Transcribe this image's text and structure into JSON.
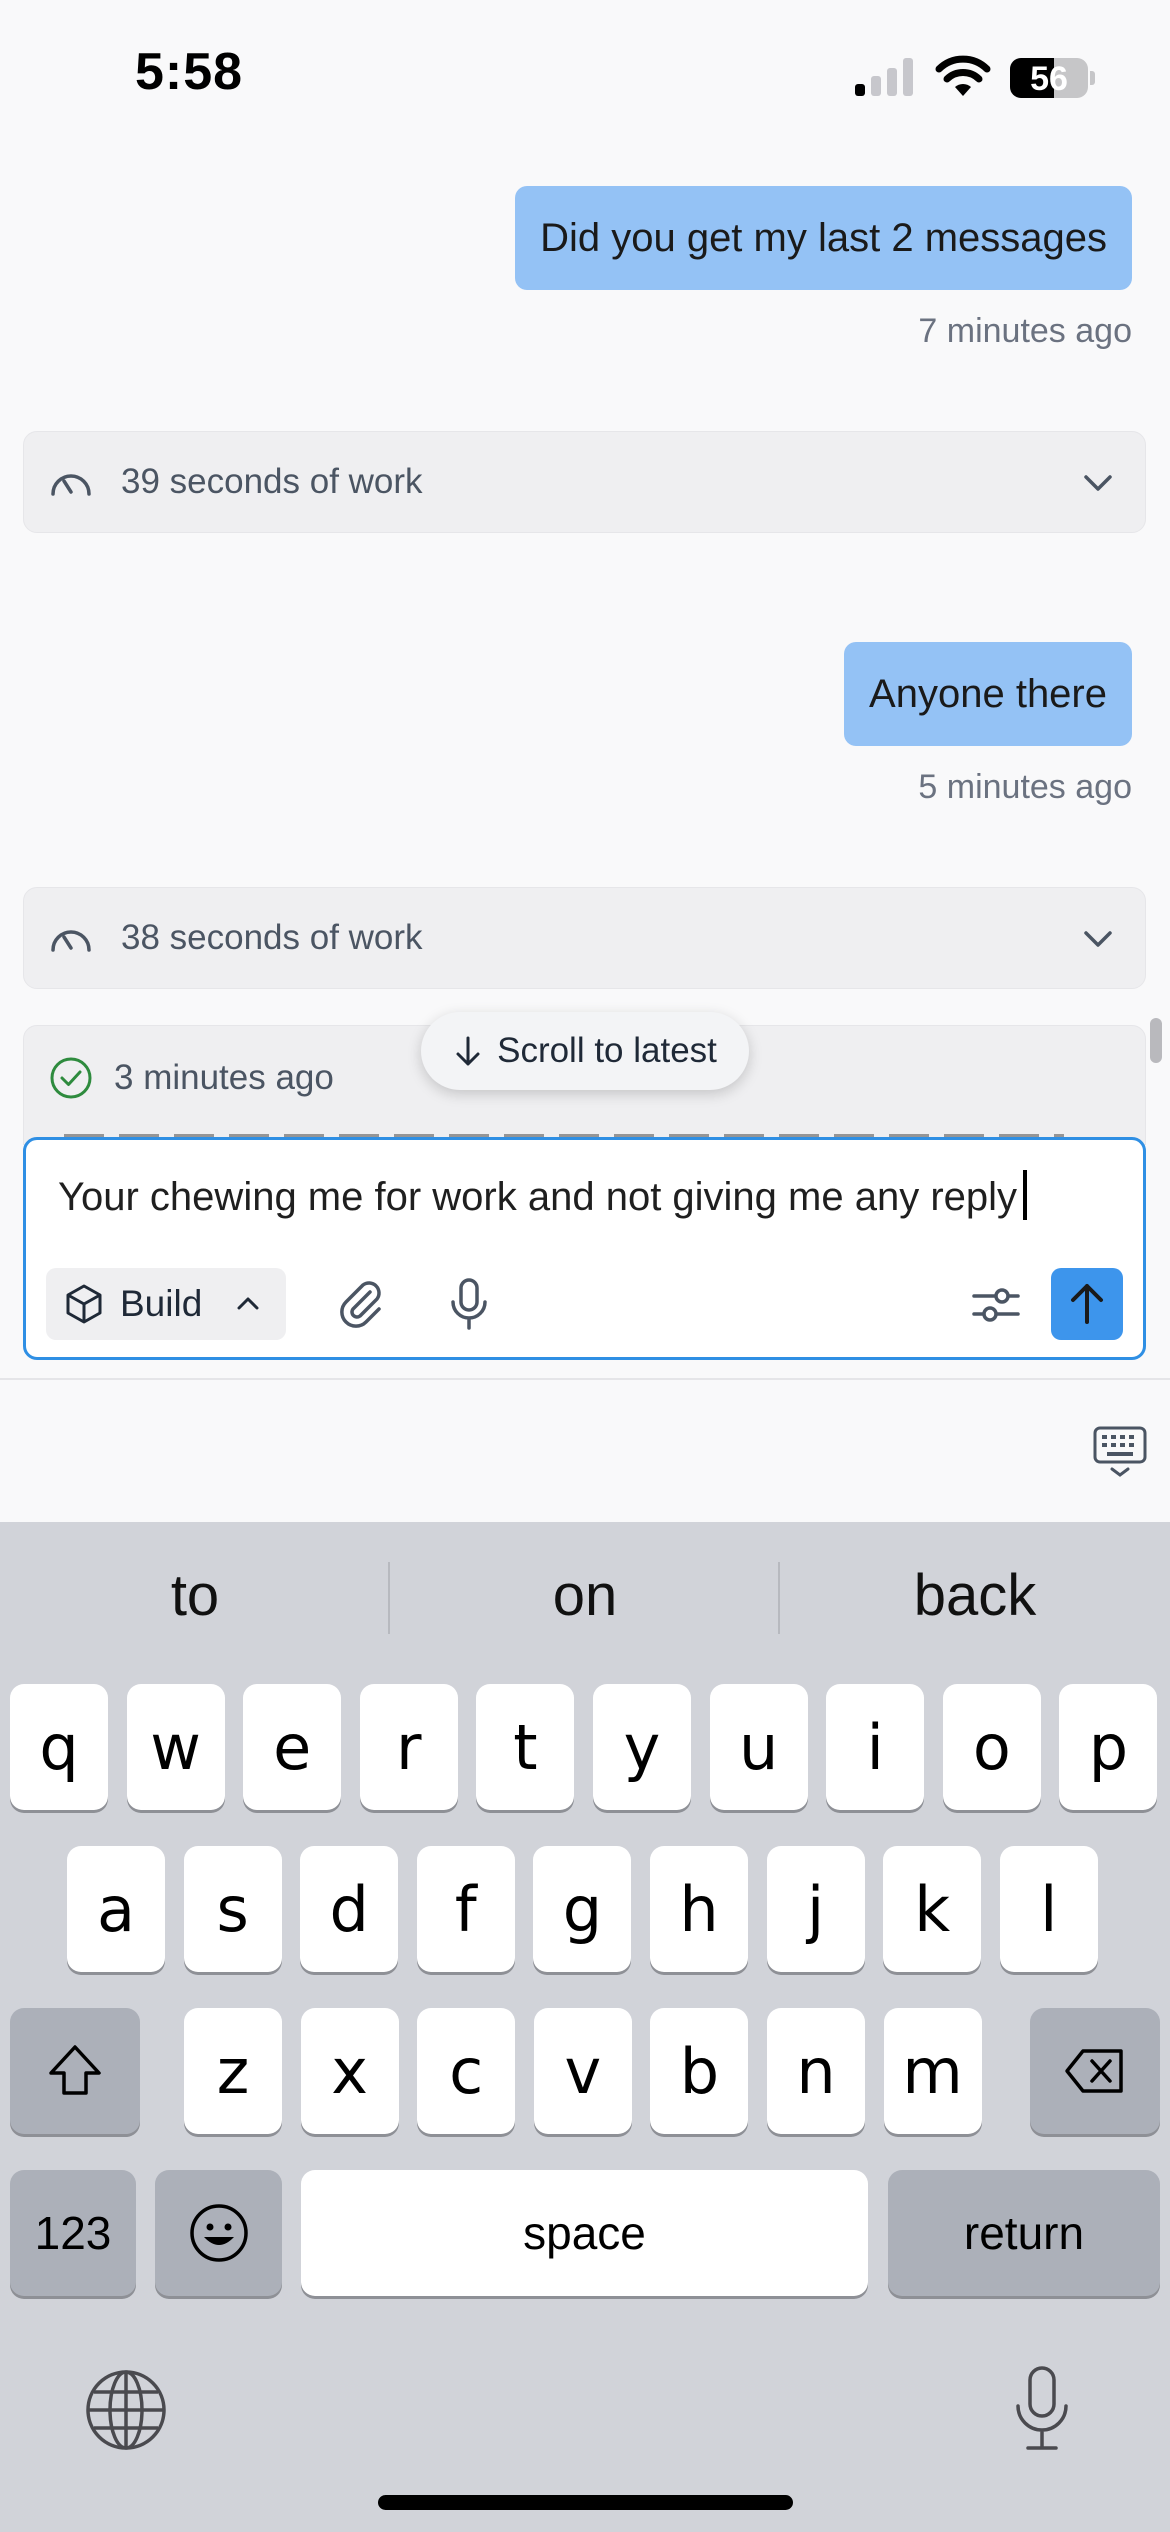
{
  "status_bar": {
    "time": "5:58",
    "battery": "56",
    "battery_level": 0.56
  },
  "messages": [
    {
      "text": "Did you get my last 2 messages",
      "time": "7 minutes ago"
    },
    {
      "text": "Anyone there",
      "time": "5 minutes ago"
    }
  ],
  "work_summaries": [
    {
      "label": "39 seconds of work"
    },
    {
      "label": "38 seconds of work"
    }
  ],
  "latest_card": {
    "time": "3 minutes ago"
  },
  "scroll_pill": {
    "label": "Scroll to latest"
  },
  "composer": {
    "text": "Your chewing me for work and not giving me any reply",
    "mode_label": "Build"
  },
  "keyboard": {
    "suggestions": [
      "to",
      "on",
      "back"
    ],
    "row1": [
      "q",
      "w",
      "e",
      "r",
      "t",
      "y",
      "u",
      "i",
      "o",
      "p"
    ],
    "row2": [
      "a",
      "s",
      "d",
      "f",
      "g",
      "h",
      "j",
      "k",
      "l"
    ],
    "row3": [
      "z",
      "x",
      "c",
      "v",
      "b",
      "n",
      "m"
    ],
    "numbers_label": "123",
    "space_label": "space",
    "return_label": "return"
  },
  "colors": {
    "user_bubble": "#94c2f5",
    "accent": "#3d95ec",
    "composer_border": "#2f8fe4",
    "success": "#2e8b3e"
  }
}
